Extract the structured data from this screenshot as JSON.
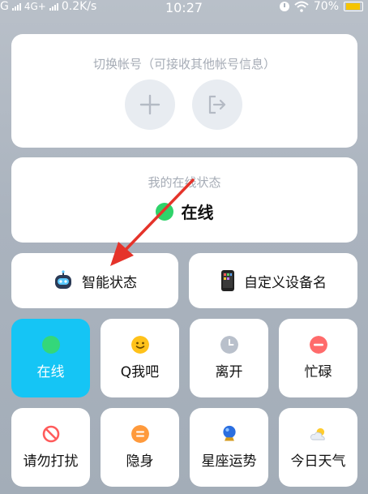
{
  "status_bar": {
    "carrier": "G",
    "network": "4G+",
    "speed": "0.2K/s",
    "time": "10:27",
    "battery": "70%",
    "icons": [
      "signal-icon",
      "alarm-icon",
      "wifi-icon",
      "battery-icon"
    ]
  },
  "account": {
    "title": "切换帐号（可接收其他帐号信息）",
    "add_icon": "plus-icon",
    "logout_icon": "logout-icon"
  },
  "online_status": {
    "caption": "我的在线状态",
    "value": "在线",
    "color": "#2fd36a"
  },
  "actions": {
    "smart_status": "智能状态",
    "custom_device_name": "自定义设备名"
  },
  "tiles": [
    {
      "label": "在线",
      "icon": "green-dot-icon",
      "active": true
    },
    {
      "label": "Q我吧",
      "icon": "smile-icon",
      "active": false
    },
    {
      "label": "离开",
      "icon": "clock-icon",
      "active": false
    },
    {
      "label": "忙碌",
      "icon": "minus-icon",
      "active": false
    },
    {
      "label": "请勿打扰",
      "icon": "no-entry-icon",
      "active": false
    },
    {
      "label": "隐身",
      "icon": "invisible-icon",
      "active": false
    },
    {
      "label": "星座运势",
      "icon": "crystal-ball-icon",
      "active": false
    },
    {
      "label": "今日天气",
      "icon": "weather-icon",
      "active": false
    }
  ],
  "colors": {
    "active_tile": "#15c5f5",
    "annotation_arrow": "#e5332a"
  }
}
